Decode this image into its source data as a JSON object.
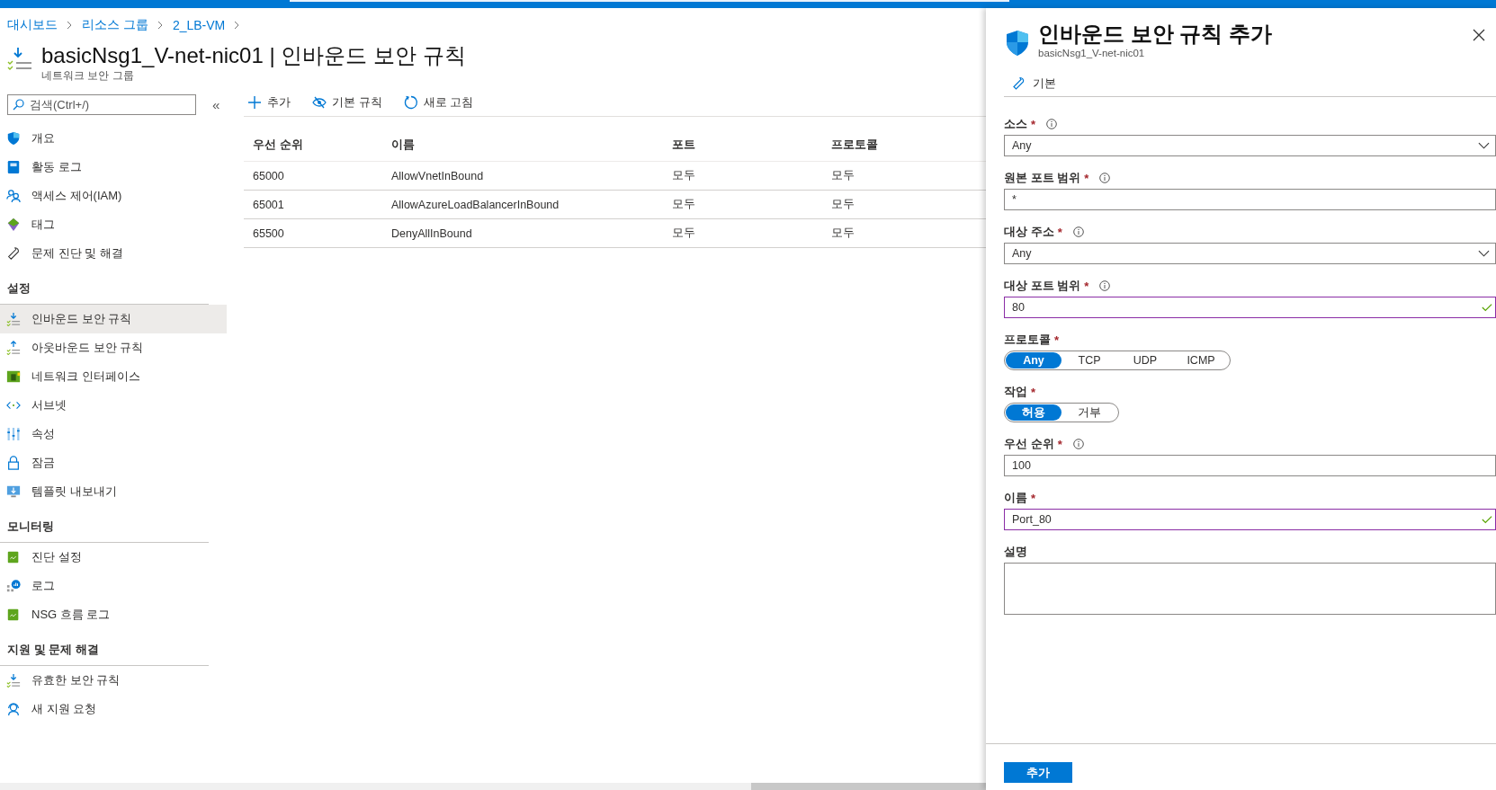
{
  "breadcrumb": [
    "대시보드",
    "리소스 그룹",
    "2_LB-VM"
  ],
  "header": {
    "title": "basicNsg1_V-net-nic01 | 인바운드 보안 규칙",
    "subtitle": "네트워크 보안 그룹"
  },
  "sidebar": {
    "search": {
      "placeholder": "검색(Ctrl+/)"
    },
    "collapse": "«",
    "items": [
      {
        "label": "개요",
        "selected": false
      },
      {
        "label": "활동 로그",
        "selected": false
      },
      {
        "label": "액세스 제어(IAM)",
        "selected": false
      },
      {
        "label": "태그",
        "selected": false
      },
      {
        "label": "문제 진단 및 해결",
        "selected": false
      }
    ],
    "sections": [
      {
        "heading": "설정",
        "items": [
          {
            "label": "인바운드 보안 규칙",
            "selected": true
          },
          {
            "label": "아웃바운드 보안 규칙",
            "selected": false
          },
          {
            "label": "네트워크 인터페이스",
            "selected": false
          },
          {
            "label": "서브넷",
            "selected": false
          },
          {
            "label": "속성",
            "selected": false
          },
          {
            "label": "잠금",
            "selected": false
          },
          {
            "label": "템플릿 내보내기",
            "selected": false
          }
        ]
      },
      {
        "heading": "모니터링",
        "items": [
          {
            "label": "진단 설정",
            "selected": false
          },
          {
            "label": "로그",
            "selected": false
          },
          {
            "label": "NSG 흐름 로그",
            "selected": false
          }
        ]
      },
      {
        "heading": "지원 및 문제 해결",
        "items": [
          {
            "label": "유효한 보안 규칙",
            "selected": false
          },
          {
            "label": "새 지원 요청",
            "selected": false
          }
        ]
      }
    ]
  },
  "toolbar": [
    "추가",
    "기본 규칙",
    "새로 고침"
  ],
  "table": {
    "columns": [
      "우선 순위",
      "이름",
      "포트",
      "프로토콜"
    ],
    "rows": [
      [
        "65000",
        "AllowVnetInBound",
        "모두",
        "모두"
      ],
      [
        "65001",
        "AllowAzureLoadBalancerInBound",
        "모두",
        "모두"
      ],
      [
        "65500",
        "DenyAllInBound",
        "모두",
        "모두"
      ]
    ]
  },
  "panel": {
    "title": "인바운드 보안 규칙 추가",
    "subtitle": "basicNsg1_V-net-nic01",
    "tab": "기본",
    "fields": [
      {
        "label": "소스",
        "required_mark": "*",
        "info": true,
        "kind": "select",
        "value": "Any"
      },
      {
        "label": "원본 포트 범위",
        "required_mark": "*",
        "info": true,
        "kind": "text",
        "value": "*",
        "valid": false
      },
      {
        "label": "대상 주소",
        "required_mark": "*",
        "info": true,
        "kind": "select",
        "value": "Any"
      },
      {
        "label": "대상 포트 범위",
        "required_mark": "*",
        "info": true,
        "kind": "text",
        "value": "80",
        "valid": true
      },
      {
        "label": "프로토콜",
        "required_mark": "*",
        "info": false,
        "kind": "toggle",
        "options": [
          {
            "label": "Any",
            "selected": true
          },
          {
            "label": "TCP",
            "selected": false
          },
          {
            "label": "UDP",
            "selected": false
          },
          {
            "label": "ICMP",
            "selected": false
          }
        ]
      },
      {
        "label": "작업",
        "required_mark": "*",
        "info": false,
        "kind": "toggle",
        "options": [
          {
            "label": "허용",
            "selected": true
          },
          {
            "label": "거부",
            "selected": false
          }
        ]
      },
      {
        "label": "우선 순위",
        "required_mark": "*",
        "info": true,
        "kind": "text",
        "value": "100",
        "valid": false
      },
      {
        "label": "이름",
        "required_mark": "*",
        "info": false,
        "kind": "text",
        "value": "Port_80",
        "valid": true
      },
      {
        "label": "설명",
        "info": false,
        "kind": "textarea"
      }
    ],
    "submit": "추가"
  }
}
